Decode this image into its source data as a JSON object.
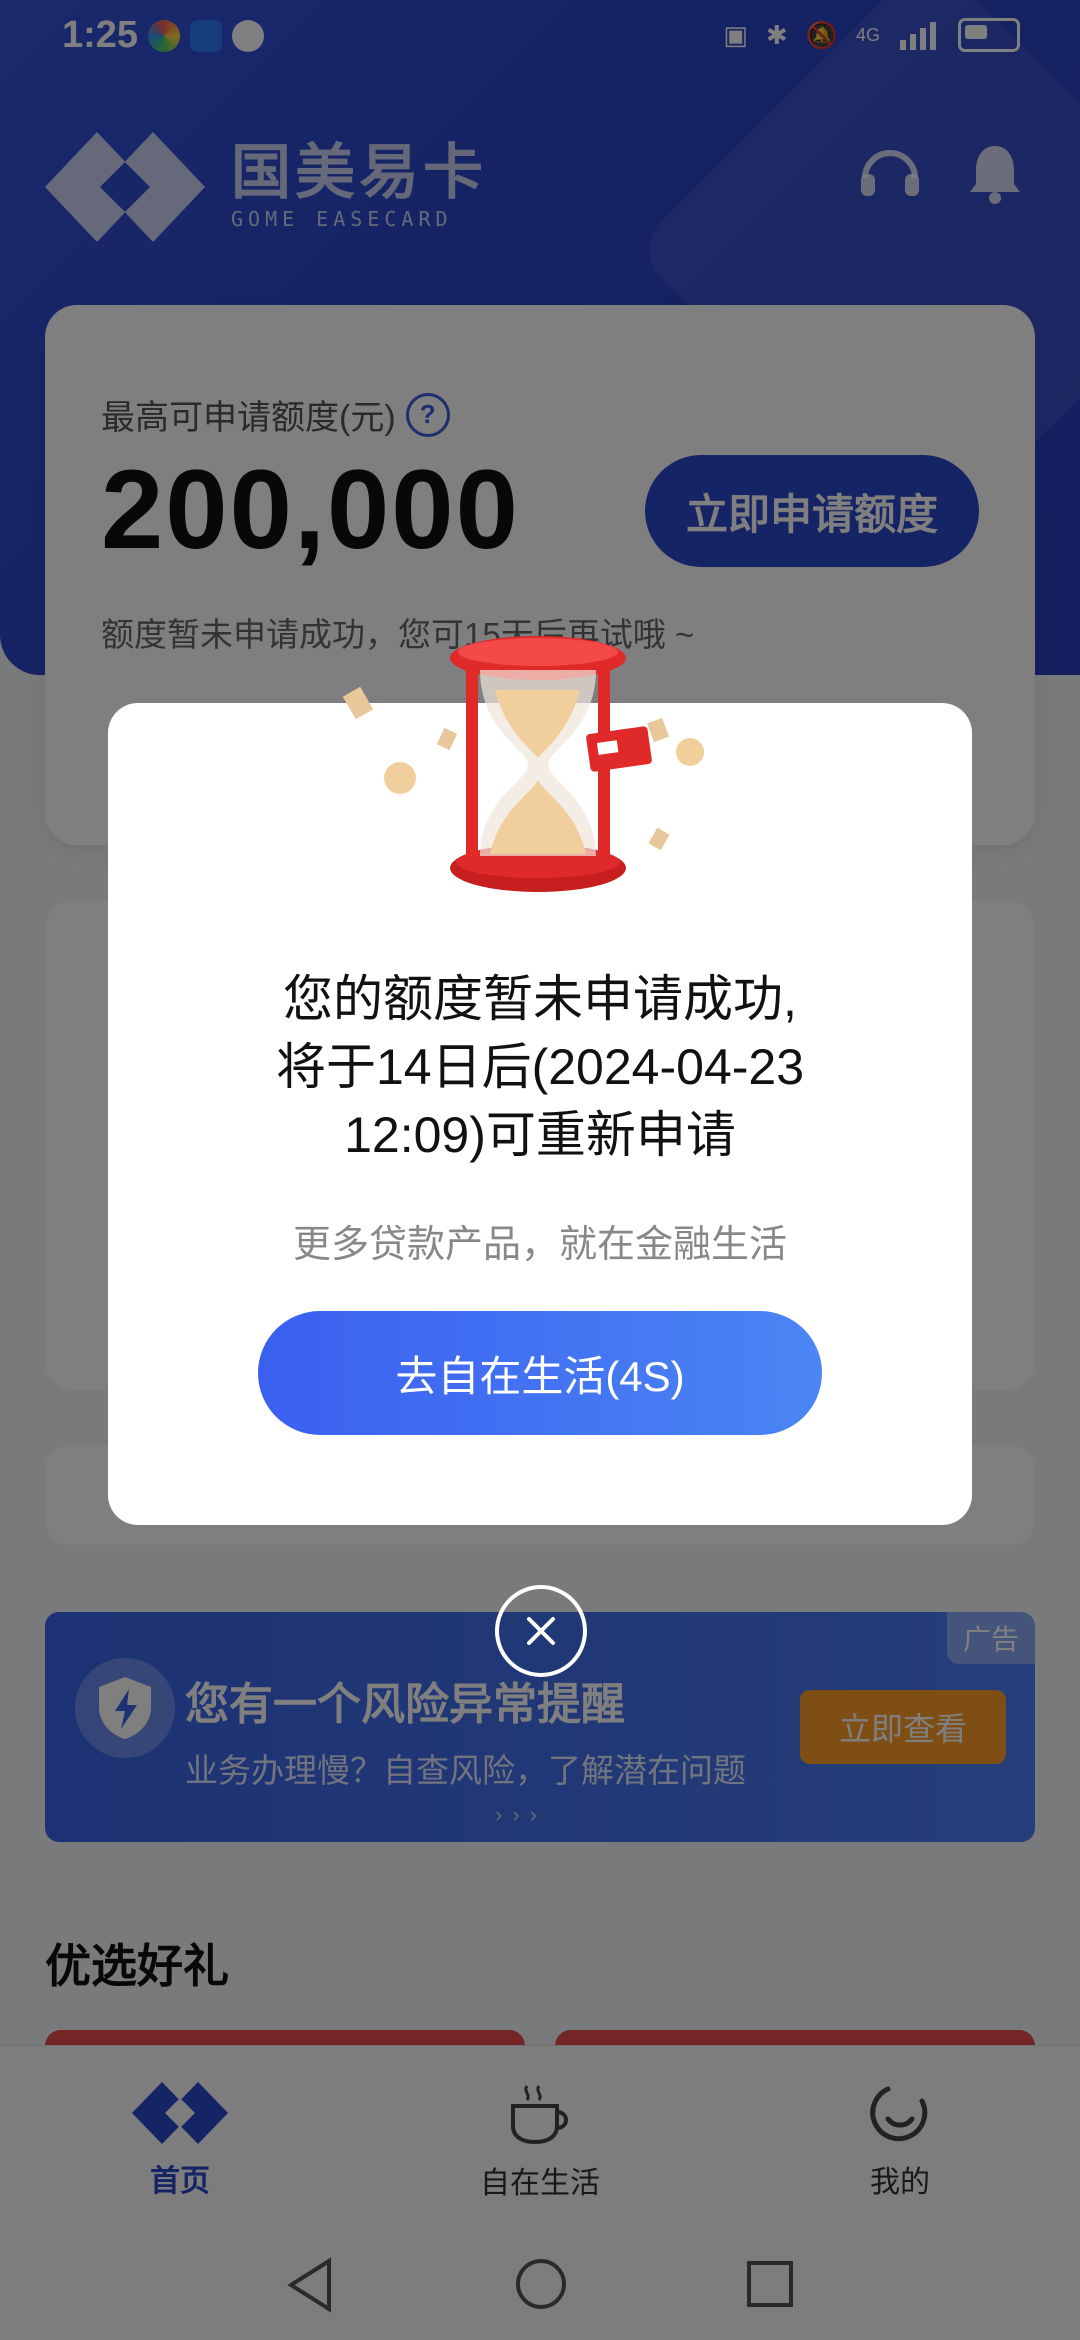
{
  "status_bar": {
    "time": "1:25",
    "network_label": "4G",
    "icons": [
      "nfc-icon",
      "bluetooth-icon",
      "mute-icon",
      "signal-icon",
      "battery-icon"
    ]
  },
  "header": {
    "brand_cn": "国美易卡",
    "brand_en": "GOME EASECARD",
    "icons": [
      "headset-icon",
      "bell-icon"
    ]
  },
  "credit_card": {
    "label": "最高可申请额度(元)",
    "help_symbol": "?",
    "amount": "200,000",
    "apply_label": "立即申请额度",
    "note": "额度暂未申请成功，您可15天后再试哦 ~"
  },
  "ad_banner": {
    "tag": "广告",
    "title": "您有一个风险异常提醒",
    "subtitle": "业务办理慢？自查风险，了解潜在问题",
    "button_label": "立即查看"
  },
  "gifts_section": {
    "title": "优选好礼"
  },
  "tab_bar": {
    "items": [
      {
        "label": "首页",
        "icon": "home-diamond-icon",
        "active": true
      },
      {
        "label": "自在生活",
        "icon": "coffee-cup-icon",
        "active": false
      },
      {
        "label": "我的",
        "icon": "profile-circle-icon",
        "active": false
      }
    ]
  },
  "modal": {
    "title_line1": "您的额度暂未申请成功,",
    "title_line2": "将于14日后(2024-04-23",
    "title_line3": "12:09)可重新申请",
    "subtitle": "更多贷款产品，就在金融生活",
    "button_label": "去自在生活(4S)",
    "close_symbol": "×"
  },
  "colors": {
    "brand_blue": "#2b48c8",
    "ad_orange": "#ff9c2b",
    "hourglass_red": "#e02a2a"
  }
}
